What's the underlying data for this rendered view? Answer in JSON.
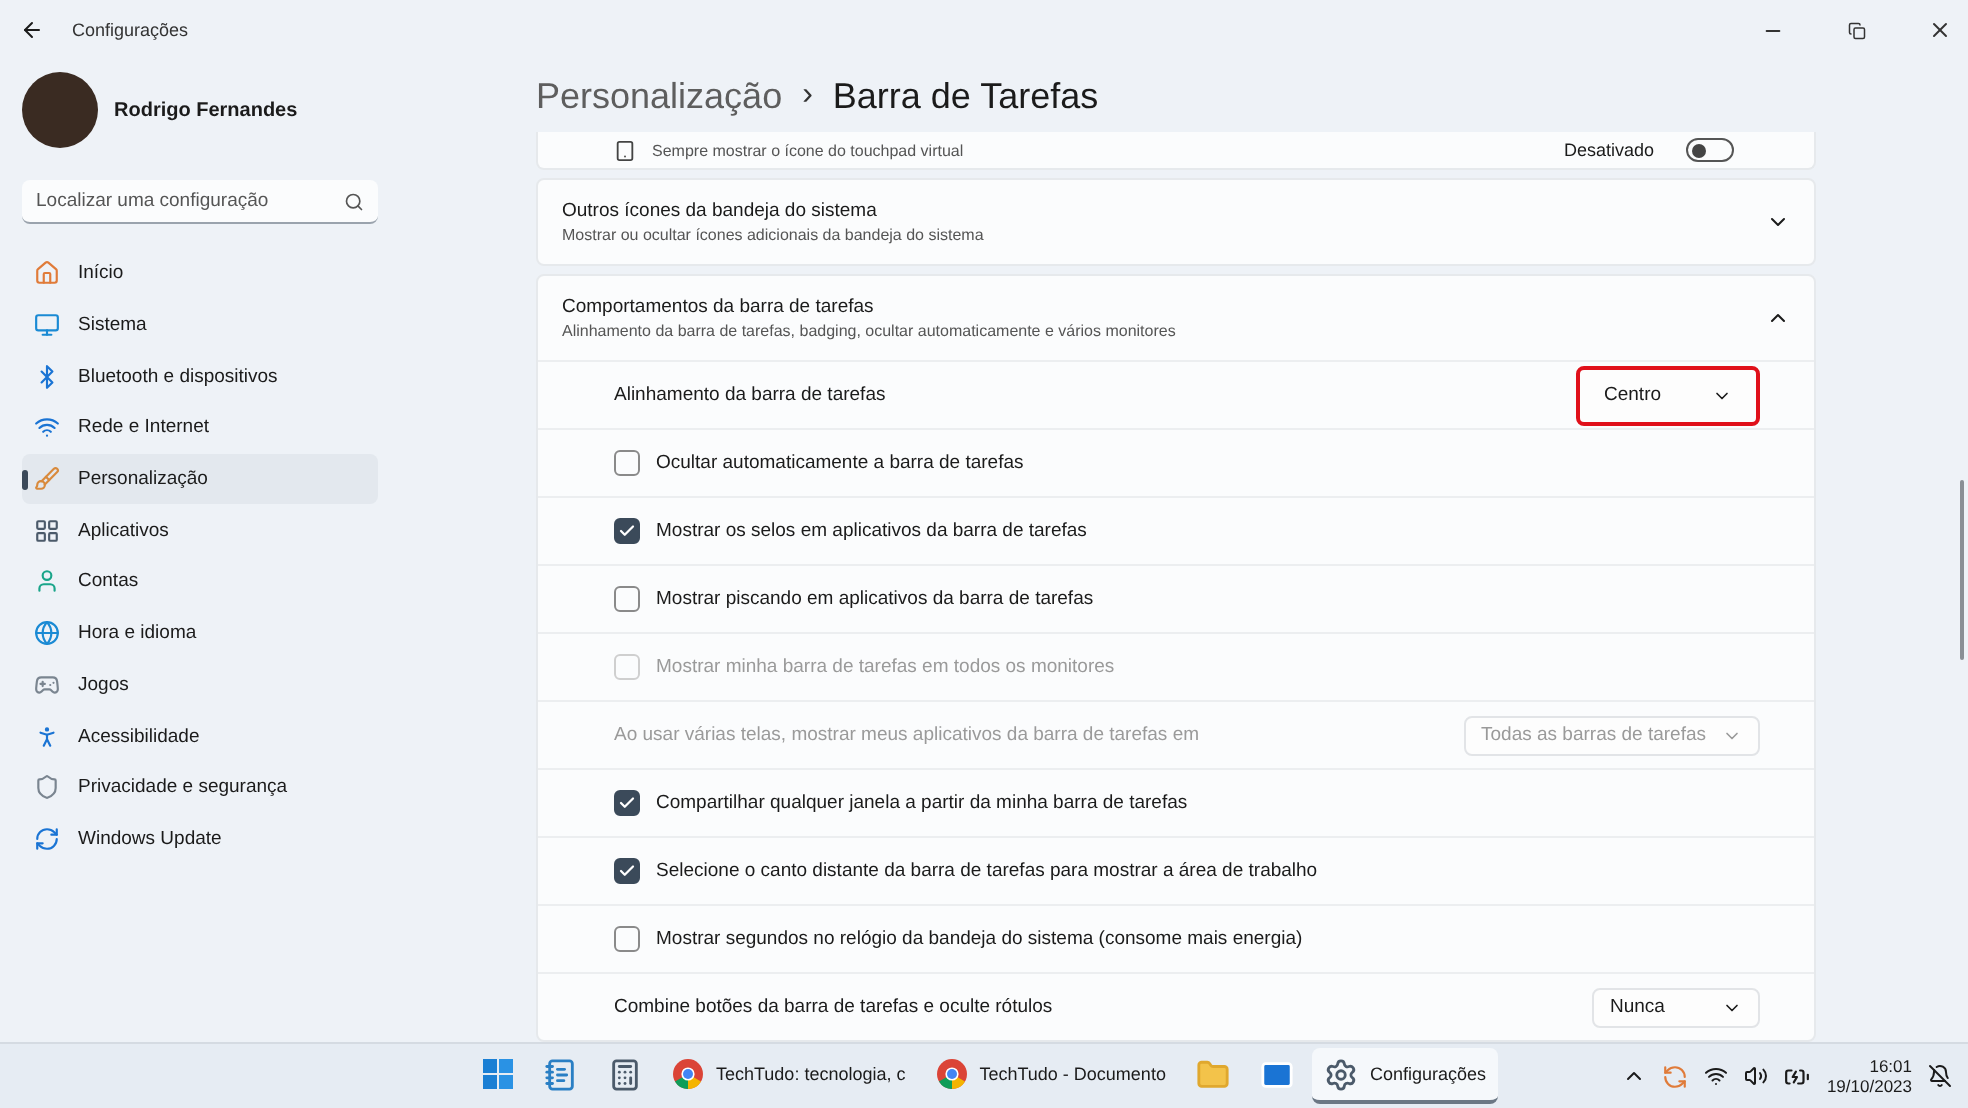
{
  "window": {
    "title": "Configurações"
  },
  "user": {
    "name": "Rodrigo Fernandes"
  },
  "search": {
    "placeholder": "Localizar uma configuração"
  },
  "nav": [
    {
      "label": "Início",
      "selected": false
    },
    {
      "label": "Sistema",
      "selected": false
    },
    {
      "label": "Bluetooth e dispositivos",
      "selected": false
    },
    {
      "label": "Rede e Internet",
      "selected": false
    },
    {
      "label": "Personalização",
      "selected": true
    },
    {
      "label": "Aplicativos",
      "selected": false
    },
    {
      "label": "Contas",
      "selected": false
    },
    {
      "label": "Hora e idioma",
      "selected": false
    },
    {
      "label": "Jogos",
      "selected": false
    },
    {
      "label": "Acessibilidade",
      "selected": false
    },
    {
      "label": "Privacidade e segurança",
      "selected": false
    },
    {
      "label": "Windows Update",
      "selected": false
    }
  ],
  "breadcrumb": {
    "parent": "Personalização",
    "separator": "›",
    "current": "Barra de Tarefas"
  },
  "partial_row": {
    "description": "Sempre mostrar o ícone do touchpad virtual",
    "state_label": "Desativado",
    "on": false
  },
  "cards": [
    {
      "title": "Outros ícones da bandeja do sistema",
      "description": "Mostrar ou ocultar ícones adicionais da bandeja do sistema",
      "expanded": false
    },
    {
      "title": "Comportamentos da barra de tarefas",
      "description": "Alinhamento da barra de tarefas, badging, ocultar automaticamente e vários monitores",
      "expanded": true
    }
  ],
  "settings": [
    {
      "kind": "dropdown",
      "label": "Alinhamento da barra de tarefas",
      "value": "Centro",
      "disabled": false,
      "highlighted": true
    },
    {
      "kind": "checkbox",
      "label": "Ocultar automaticamente a barra de tarefas",
      "checked": false,
      "disabled": false
    },
    {
      "kind": "checkbox",
      "label": "Mostrar os selos em aplicativos da barra de tarefas",
      "checked": true,
      "disabled": false
    },
    {
      "kind": "checkbox",
      "label": "Mostrar piscando em aplicativos da barra de tarefas",
      "checked": false,
      "disabled": false
    },
    {
      "kind": "checkbox",
      "label": "Mostrar minha barra de tarefas em todos os monitores",
      "checked": false,
      "disabled": true
    },
    {
      "kind": "dropdown",
      "label": "Ao usar várias telas, mostrar meus aplicativos da barra de tarefas em",
      "value": "Todas as barras de tarefas",
      "disabled": true
    },
    {
      "kind": "checkbox",
      "label": "Compartilhar qualquer janela a partir da minha barra de tarefas",
      "checked": true,
      "disabled": false
    },
    {
      "kind": "checkbox",
      "label": "Selecione o canto distante da barra de tarefas para mostrar a área de trabalho",
      "checked": true,
      "disabled": false
    },
    {
      "kind": "checkbox",
      "label": "Mostrar segundos no relógio da bandeja do sistema (consome mais energia)",
      "checked": false,
      "disabled": false
    },
    {
      "kind": "dropdown",
      "label": "Combine botões da barra de tarefas e oculte rótulos",
      "value": "Nunca",
      "disabled": false
    }
  ],
  "taskbar": {
    "apps": [
      {
        "active": false
      },
      {
        "active": false
      },
      {
        "active": false
      },
      {
        "label": "TechTudo: tecnologia, c",
        "active": false
      },
      {
        "label": "TechTudo - Documento",
        "active": false
      },
      {
        "active": false
      },
      {
        "active": false
      },
      {
        "label": "Configurações",
        "active": true
      }
    ],
    "time": "16:01",
    "date": "19/10/2023"
  }
}
